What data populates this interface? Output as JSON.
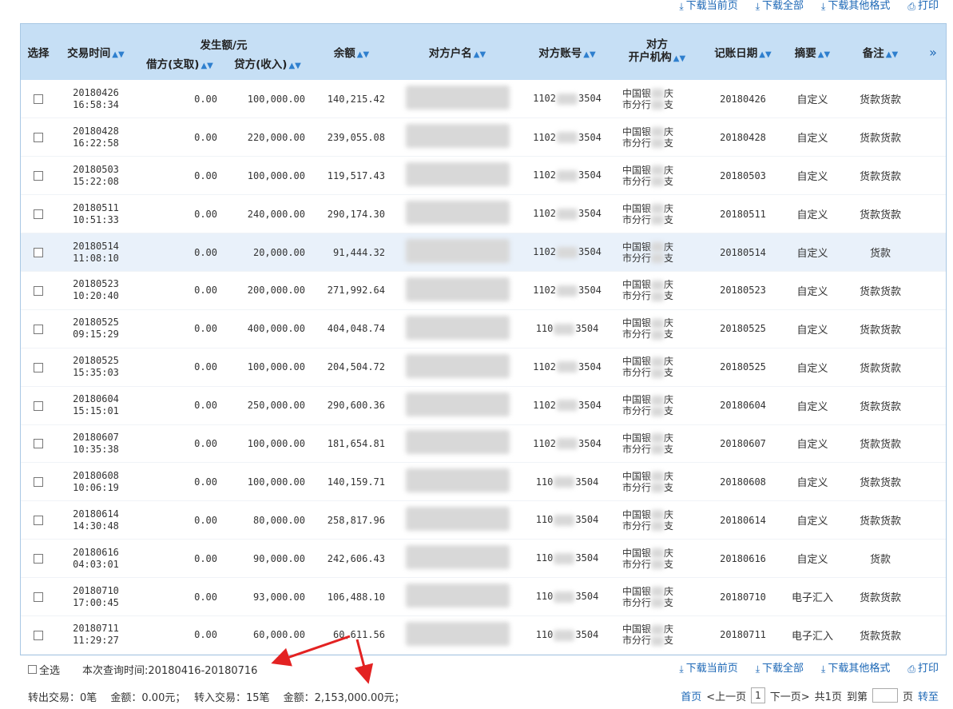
{
  "toolbar": {
    "download_current": "下载当前页",
    "download_all": "下载全部",
    "download_other": "下载其他格式",
    "print": "打印"
  },
  "table": {
    "headers": {
      "select": "选择",
      "time": "交易时间",
      "amount_group": "发生额/元",
      "debit": "借方(支取)",
      "credit": "贷方(收入)",
      "balance": "余额",
      "name": "对方户名",
      "account": "对方账号",
      "org_line1": "对方",
      "org_line2": "开户机构",
      "post_date": "记账日期",
      "summary": "摘要",
      "remark": "备注",
      "more": "»"
    },
    "rows": [
      {
        "date": "20180426",
        "time": "16:58:34",
        "debit": "0.00",
        "credit": "100,000.00",
        "balance": "140,215.42",
        "acct_prefix": "1102",
        "acct_suffix": "3504",
        "org_a": "中国银",
        "org_b": "庆",
        "org_c": "市分行",
        "org_d": "支",
        "post": "20180426",
        "summary": "自定义",
        "remark": "货款货款"
      },
      {
        "date": "20180428",
        "time": "16:22:58",
        "debit": "0.00",
        "credit": "220,000.00",
        "balance": "239,055.08",
        "acct_prefix": "1102",
        "acct_suffix": "3504",
        "org_a": "中国银",
        "org_b": "庆",
        "org_c": "市分行",
        "org_d": "支",
        "post": "20180428",
        "summary": "自定义",
        "remark": "货款货款"
      },
      {
        "date": "20180503",
        "time": "15:22:08",
        "debit": "0.00",
        "credit": "100,000.00",
        "balance": "119,517.43",
        "acct_prefix": "1102",
        "acct_suffix": "3504",
        "org_a": "中国银",
        "org_b": "庆",
        "org_c": "市分行",
        "org_d": "支",
        "post": "20180503",
        "summary": "自定义",
        "remark": "货款货款"
      },
      {
        "date": "20180511",
        "time": "10:51:33",
        "debit": "0.00",
        "credit": "240,000.00",
        "balance": "290,174.30",
        "acct_prefix": "1102",
        "acct_suffix": "3504",
        "org_a": "中国银",
        "org_b": "庆",
        "org_c": "市分行",
        "org_d": "支",
        "post": "20180511",
        "summary": "自定义",
        "remark": "货款货款"
      },
      {
        "date": "20180514",
        "time": "11:08:10",
        "debit": "0.00",
        "credit": "20,000.00",
        "balance": "91,444.32",
        "acct_prefix": "1102",
        "acct_suffix": "3504",
        "org_a": "中国银",
        "org_b": "庆",
        "org_c": "市分行",
        "org_d": "支",
        "post": "20180514",
        "summary": "自定义",
        "remark": "货款"
      },
      {
        "date": "20180523",
        "time": "10:20:40",
        "debit": "0.00",
        "credit": "200,000.00",
        "balance": "271,992.64",
        "acct_prefix": "1102",
        "acct_suffix": "3504",
        "org_a": "中国银",
        "org_b": "庆",
        "org_c": "市分行",
        "org_d": "支",
        "post": "20180523",
        "summary": "自定义",
        "remark": "货款货款"
      },
      {
        "date": "20180525",
        "time": "09:15:29",
        "debit": "0.00",
        "credit": "400,000.00",
        "balance": "404,048.74",
        "acct_prefix": "110",
        "acct_suffix": "3504",
        "org_a": "中国银",
        "org_b": "庆",
        "org_c": "市分行",
        "org_d": "支",
        "post": "20180525",
        "summary": "自定义",
        "remark": "货款货款"
      },
      {
        "date": "20180525",
        "time": "15:35:03",
        "debit": "0.00",
        "credit": "100,000.00",
        "balance": "204,504.72",
        "acct_prefix": "1102",
        "acct_suffix": "3504",
        "org_a": "中国银",
        "org_b": "庆",
        "org_c": "市分行",
        "org_d": "支",
        "post": "20180525",
        "summary": "自定义",
        "remark": "货款货款"
      },
      {
        "date": "20180604",
        "time": "15:15:01",
        "debit": "0.00",
        "credit": "250,000.00",
        "balance": "290,600.36",
        "acct_prefix": "1102",
        "acct_suffix": "3504",
        "org_a": "中国银",
        "org_b": "庆",
        "org_c": "市分行",
        "org_d": "支",
        "post": "20180604",
        "summary": "自定义",
        "remark": "货款货款"
      },
      {
        "date": "20180607",
        "time": "10:35:38",
        "debit": "0.00",
        "credit": "100,000.00",
        "balance": "181,654.81",
        "acct_prefix": "1102",
        "acct_suffix": "3504",
        "org_a": "中国银",
        "org_b": "庆",
        "org_c": "市分行",
        "org_d": "支",
        "post": "20180607",
        "summary": "自定义",
        "remark": "货款货款"
      },
      {
        "date": "20180608",
        "time": "10:06:19",
        "debit": "0.00",
        "credit": "100,000.00",
        "balance": "140,159.71",
        "acct_prefix": "110",
        "acct_suffix": "3504",
        "org_a": "中国银",
        "org_b": "庆",
        "org_c": "市分行",
        "org_d": "支",
        "post": "20180608",
        "summary": "自定义",
        "remark": "货款货款"
      },
      {
        "date": "20180614",
        "time": "14:30:48",
        "debit": "0.00",
        "credit": "80,000.00",
        "balance": "258,817.96",
        "acct_prefix": "110",
        "acct_suffix": "3504",
        "org_a": "中国银",
        "org_b": "庆",
        "org_c": "市分行",
        "org_d": "支",
        "post": "20180614",
        "summary": "自定义",
        "remark": "货款货款"
      },
      {
        "date": "20180616",
        "time": "04:03:01",
        "debit": "0.00",
        "credit": "90,000.00",
        "balance": "242,606.43",
        "acct_prefix": "110",
        "acct_suffix": "3504",
        "org_a": "中国银",
        "org_b": "庆",
        "org_c": "市分行",
        "org_d": "支",
        "post": "20180616",
        "summary": "自定义",
        "remark": "货款"
      },
      {
        "date": "20180710",
        "time": "17:00:45",
        "debit": "0.00",
        "credit": "93,000.00",
        "balance": "106,488.10",
        "acct_prefix": "110",
        "acct_suffix": "3504",
        "org_a": "中国银",
        "org_b": "庆",
        "org_c": "市分行",
        "org_d": "支",
        "post": "20180710",
        "summary": "电子汇入",
        "remark": "货款货款"
      },
      {
        "date": "20180711",
        "time": "11:29:27",
        "debit": "0.00",
        "credit": "60,000.00",
        "balance": "60,611.56",
        "acct_prefix": "110",
        "acct_suffix": "3504",
        "org_a": "中国银",
        "org_b": "庆",
        "org_c": "市分行",
        "org_d": "支",
        "post": "20180711",
        "summary": "电子汇入",
        "remark": "货款货款"
      }
    ]
  },
  "footer": {
    "select_all": "全选",
    "query_period": "本次查询时间:20180416-20180716",
    "summary_line": "转出交易：0笔　 金额：0.00元；　 转入交易：15笔　 金额：2,153,000.00元；"
  },
  "pager": {
    "first": "首页",
    "prev": "<上一页",
    "page": "1",
    "next": "下一页>",
    "total": "共1页",
    "goto_prefix": "到第",
    "goto_suffix": "页",
    "go": "转至"
  },
  "colors": {
    "link": "#1a66b5",
    "header_bg": "#c6dff5",
    "alt_row": "#e9f1fa",
    "arrow": "#e32222"
  }
}
